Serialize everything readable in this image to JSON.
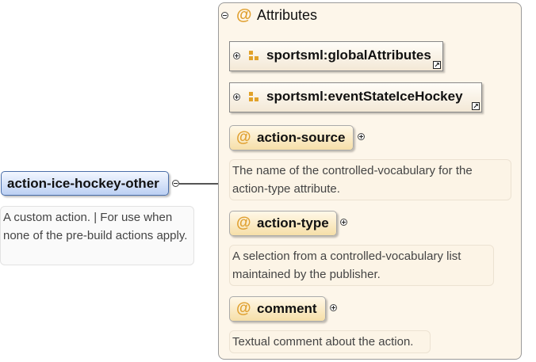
{
  "element": {
    "name": "action-ice-hockey-other",
    "doc": "A custom action. | For use when none of the pre-build actions apply."
  },
  "attributes": {
    "title": "Attributes",
    "groups": [
      {
        "name": "sportsml:globalAttributes"
      },
      {
        "name": "sportsml:eventStateIceHockey"
      }
    ],
    "items": [
      {
        "name": "action-source",
        "doc": "The name of the controlled-vocabulary for the action-type attribute."
      },
      {
        "name": "action-type",
        "doc": "A selection from a controlled-vocabulary list maintained by the publisher."
      },
      {
        "name": "comment",
        "doc": "Textual comment about the action."
      }
    ]
  },
  "colors": {
    "element_border": "#4a6ea9",
    "attr_accent": "#e0a030",
    "panel_bg": "#fdf6ea"
  },
  "icons": {
    "collapse": "minus-circle-icon",
    "expand": "plus-circle-icon",
    "attribute": "at-sign-icon",
    "group": "attribute-group-icon",
    "reference": "reference-arrow-icon"
  }
}
